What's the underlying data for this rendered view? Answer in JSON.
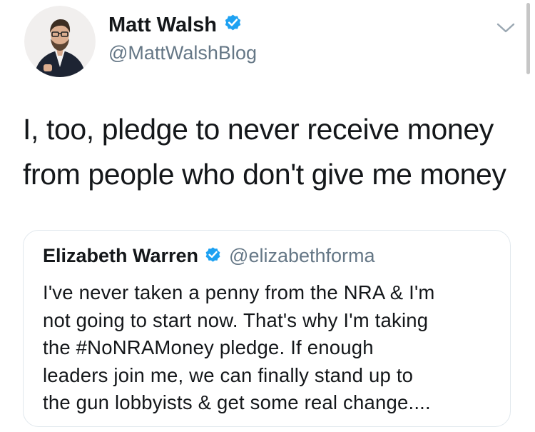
{
  "tweet": {
    "author_name": "Matt Walsh",
    "author_handle": "@MattWalshBlog",
    "verified": true,
    "text_lines": [
      "I, too, pledge to never receive money",
      "from people who don't give me money"
    ]
  },
  "quoted_tweet": {
    "author_name": "Elizabeth Warren",
    "author_handle": "@elizabethforma",
    "verified": true,
    "text_lines": [
      "I've never taken a penny from the NRA & I'm",
      "not going to start now. That's why I'm taking",
      "the #NoNRAMoney pledge. If enough",
      "leaders join me, we can finally stand up to",
      "the gun lobbyists & get some real change...."
    ]
  },
  "icons": {
    "verified": "verified-badge-icon",
    "menu": "chevron-down-icon"
  },
  "colors": {
    "verified_blue": "#1da1f2",
    "handle_gray": "#657786",
    "text": "#14171a",
    "card_border": "#e1e8ed"
  }
}
